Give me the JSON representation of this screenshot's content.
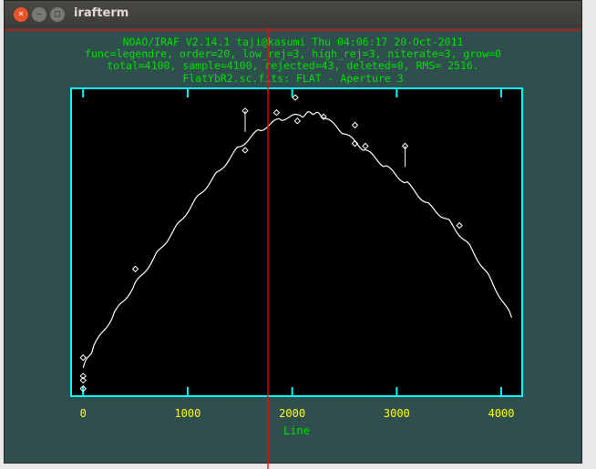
{
  "window": {
    "title": "irafterm"
  },
  "header": [
    "NOAO/IRAF V2.14.1 taji@kasumi Thu 04:06:17 20-Oct-2011",
    "func=legendre, order=20, low_rej=3, high_rej=3, niterate=3, grow=0",
    "total=4100, sample=4100, rejected=43, deleted=0, RMS=  2516.",
    "FlatYbR2.sc.fits: FLAT - Aperture 3"
  ],
  "chart_data": {
    "type": "line",
    "title": "FlatYbR2.sc.fits: FLAT - Aperture 3",
    "xlabel": "Line",
    "ylabel": "",
    "xlim": [
      -115,
      4200
    ],
    "ylim": [
      186000,
      554000
    ],
    "xticks": [
      "0",
      "1000",
      "2000",
      "3000",
      "4000"
    ],
    "yticks": [
      "2.00E5",
      "2.50E5",
      "3.00E5",
      "3.50E5",
      "4.00E5",
      "4.50E5",
      "5.00E5",
      "5.50E5"
    ],
    "series": [
      {
        "name": "data",
        "x": [
          0,
          100,
          300,
          500,
          700,
          900,
          1100,
          1300,
          1500,
          1700,
          1900,
          2100,
          2200,
          2300,
          2500,
          2700,
          2900,
          3100,
          3300,
          3500,
          3700,
          3900,
          4100
        ],
        "y": [
          220000,
          245000,
          285000,
          320000,
          355000,
          390000,
          425000,
          455000,
          485000,
          505000,
          518000,
          522000,
          525000,
          520000,
          500000,
          480000,
          460000,
          440000,
          415000,
          395000,
          365000,
          325000,
          280000
        ]
      }
    ],
    "rejected": {
      "x": [
        0,
        0,
        0,
        0,
        500,
        1550,
        1550,
        1850,
        2030,
        2050,
        2300,
        2600,
        2600,
        2700,
        3080,
        3600
      ],
      "y": [
        195000,
        205000,
        210000,
        232000,
        338000,
        527000,
        480000,
        525000,
        543000,
        515000,
        520000,
        510000,
        488000,
        485000,
        485000,
        390000
      ]
    }
  },
  "colors": {
    "axis": "#00ffff",
    "tick_label": "#ffff00",
    "header": "#00e000",
    "curve": "#ffffff",
    "cursor": "#ff0000"
  }
}
